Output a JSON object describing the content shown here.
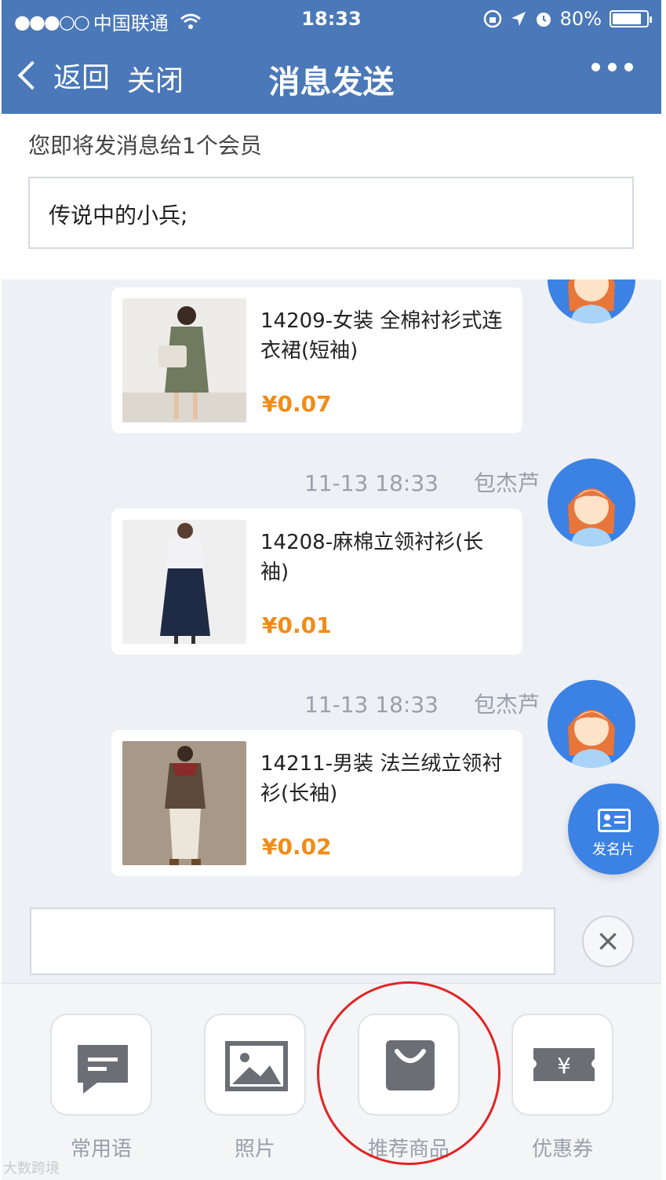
{
  "status_bar": {
    "carrier": "中国联通",
    "time": "18:33",
    "battery": "80%",
    "battery_level": 0.8,
    "icons": [
      "signal-dots-icon",
      "wifi-icon",
      "rotation-lock-icon",
      "location-arrow-icon",
      "alarm-icon",
      "battery-icon"
    ]
  },
  "nav": {
    "back_label": "返回",
    "close_label": "关闭",
    "title": "消息发送",
    "more_icon": "more-dots-icon"
  },
  "recipient": {
    "hint": "您即将发消息给1个会员",
    "value": "传说中的小兵;"
  },
  "messages": [
    {
      "date": "",
      "sender": "",
      "product_name": "14209-女装 全棉衬衫式连衣裙(短袖)",
      "price": "¥0.07",
      "thumb_color": "#6f7a5e"
    },
    {
      "date": "11-13 18:33",
      "sender": "包杰芦",
      "product_name": "14208-麻棉立领衬衫(长袖)",
      "price": "¥0.01",
      "thumb_color": "#1f2a44"
    },
    {
      "date": "11-13 18:33",
      "sender": "包杰芦",
      "product_name": "14211-男装 法兰绒立领衬衫(长袖)",
      "price": "¥0.02",
      "thumb_color": "#6b5a4a"
    }
  ],
  "fab": {
    "label": "发名片",
    "icon": "business-card-icon"
  },
  "input": {
    "value": "",
    "clear_icon": "close-icon"
  },
  "toolbar": {
    "items": [
      {
        "label": "常用语",
        "icon": "chat-bubble-icon"
      },
      {
        "label": "照片",
        "icon": "image-icon"
      },
      {
        "label": "推荐商品",
        "icon": "shopping-bag-icon"
      },
      {
        "label": "优惠券",
        "icon": "coupon-icon"
      }
    ]
  },
  "colors": {
    "nav_bg": "#4a78b8",
    "price": "#f08c1a",
    "accent_blue": "#3b82e4",
    "highlight_red": "#e22323"
  },
  "watermark": "大数跨境"
}
